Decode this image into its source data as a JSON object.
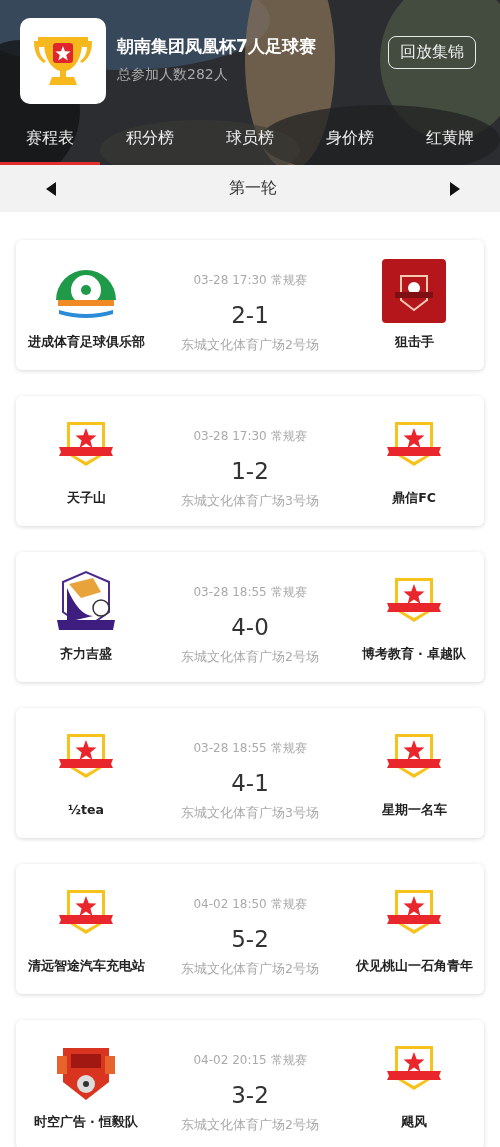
{
  "header": {
    "title": "朝南集团凤凰杯7人足球赛",
    "subtitle": "总参加人数282人",
    "button": "回放集锦"
  },
  "tabs": [
    {
      "label": "赛程表",
      "selected": true
    },
    {
      "label": "积分榜",
      "selected": false
    },
    {
      "label": "球员榜",
      "selected": false
    },
    {
      "label": "身价榜",
      "selected": false
    },
    {
      "label": "红黄牌",
      "selected": false
    }
  ],
  "round": {
    "label": "第一轮"
  },
  "matches": [
    {
      "time": "03-28 17:30 常规赛",
      "score": "2-1",
      "venue": "东城文化体育广场2号场",
      "home": {
        "name": "进成体育足球俱乐部",
        "kind": "green"
      },
      "away": {
        "name": "狙击手",
        "kind": "square"
      }
    },
    {
      "time": "03-28 17:30 常规赛",
      "score": "1-2",
      "venue": "东城文化体育广场3号场",
      "home": {
        "name": "天子山",
        "kind": "default"
      },
      "away": {
        "name": "鼎信FC",
        "kind": "default"
      }
    },
    {
      "time": "03-28 18:55 常规赛",
      "score": "4-0",
      "venue": "东城文化体育广场2号场",
      "home": {
        "name": "齐力吉盛",
        "kind": "purple"
      },
      "away": {
        "name": "博考教育 · 卓越队",
        "kind": "default"
      }
    },
    {
      "time": "03-28 18:55 常规赛",
      "score": "4-1",
      "venue": "东城文化体育广场3号场",
      "home": {
        "name": "½tea",
        "kind": "default"
      },
      "away": {
        "name": "星期一名车",
        "kind": "default"
      }
    },
    {
      "time": "04-02 18:50 常规赛",
      "score": "5-2",
      "venue": "东城文化体育广场2号场",
      "home": {
        "name": "清远智途汽车充电站",
        "kind": "default"
      },
      "away": {
        "name": "伏见桃山一石角青年",
        "kind": "default"
      }
    },
    {
      "time": "04-02 20:15 常规赛",
      "score": "3-2",
      "venue": "东城文化体育广场2号场",
      "home": {
        "name": "时空广告 · 恒毅队",
        "kind": "crest"
      },
      "away": {
        "name": "飓风",
        "kind": "default"
      }
    }
  ]
}
